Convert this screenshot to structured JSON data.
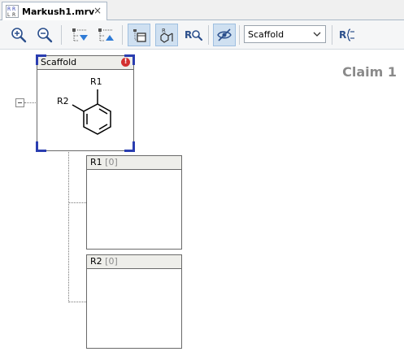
{
  "tab": {
    "title": "Markush1.mrv",
    "close_glyph": "×",
    "icon": "markush-document-icon"
  },
  "toolbar": {
    "buttons": [
      {
        "name": "zoom-in-button",
        "icon": "zoom-in-icon"
      },
      {
        "name": "zoom-out-button",
        "icon": "zoom-out-icon"
      },
      {
        "name": "expand-all-button",
        "icon": "expand-all-icon"
      },
      {
        "name": "collapse-all-button",
        "icon": "collapse-all-icon"
      },
      {
        "name": "scaffold-view-button",
        "icon": "scaffold-view-icon",
        "active": true
      },
      {
        "name": "rgroup-structure-button",
        "icon": "rgroup-structure-icon",
        "active": true
      },
      {
        "name": "rgroup-search-button",
        "icon": "rgroup-search-icon",
        "text": "R"
      },
      {
        "name": "hide-button",
        "icon": "hide-eye-icon",
        "active": true
      },
      {
        "name": "rgroup-definition-button",
        "icon": "rgroup-definition-icon",
        "text": "R"
      }
    ],
    "view_select": {
      "value": "Scaffold",
      "options": [
        "Scaffold"
      ]
    }
  },
  "canvas": {
    "claim_label": "Claim 1",
    "scaffold": {
      "title": "Scaffold",
      "error_badge": "!",
      "atom_labels": {
        "r1": "R1",
        "r2": "R2"
      }
    },
    "rgroups": [
      {
        "label": "R1",
        "count": "[0]"
      },
      {
        "label": "R2",
        "count": "[0]"
      }
    ]
  },
  "colors": {
    "selection": "#2a3db0",
    "error": "#d32f2f",
    "active_button_bg": "#cfe0f1",
    "claim_label": "#8a8a8a"
  }
}
